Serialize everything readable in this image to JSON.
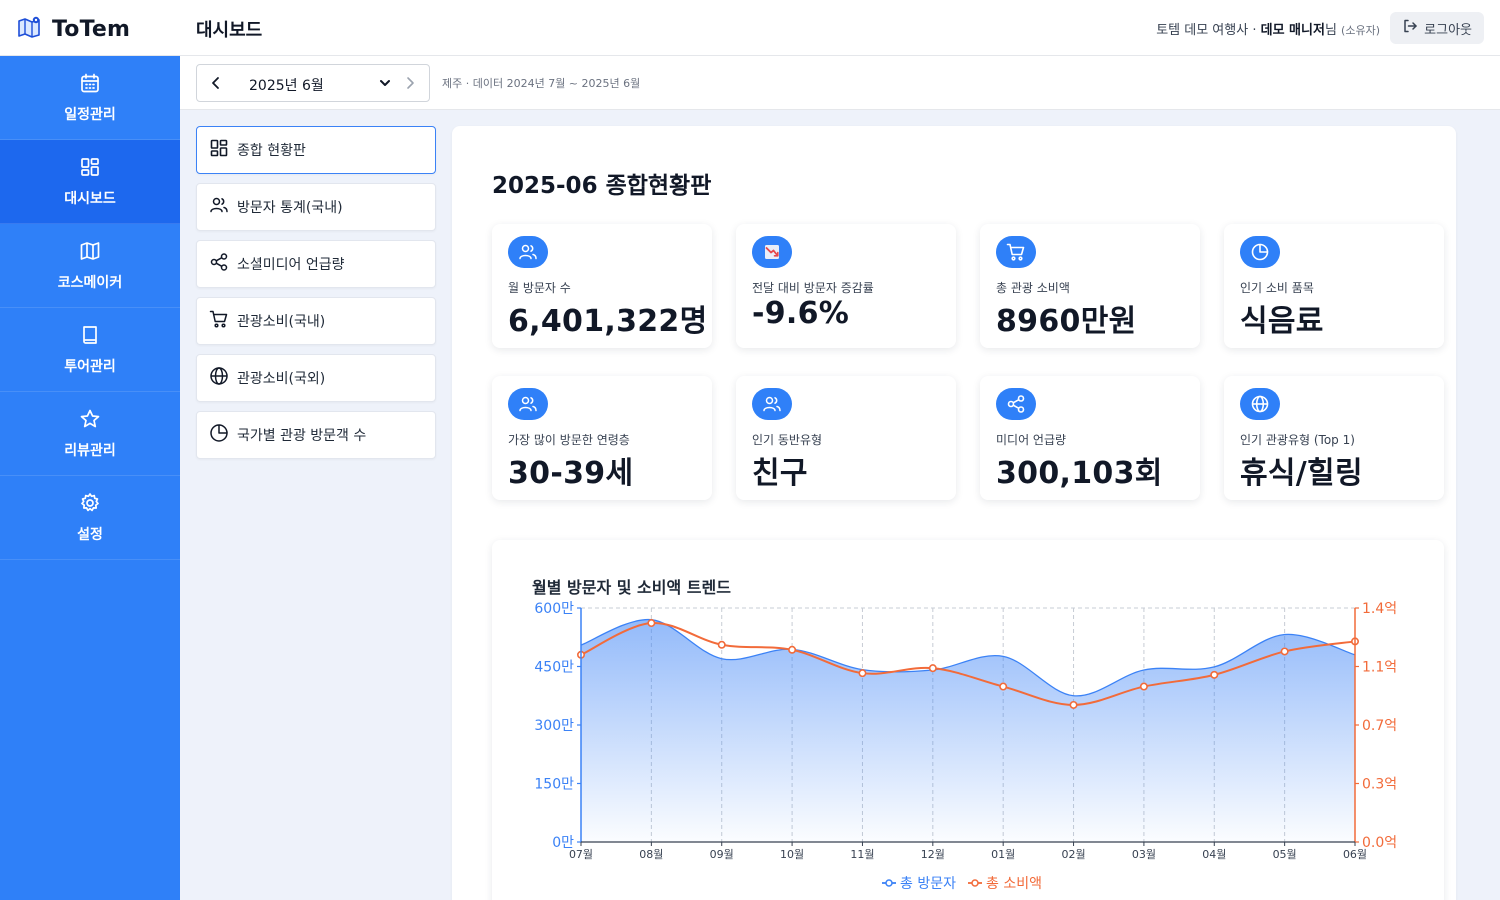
{
  "app": {
    "name": "ToTem"
  },
  "header": {
    "title": "대시보드",
    "company": "토템 데모 여행사",
    "separator": " · ",
    "user_name": "데모 매니저",
    "honorific": "님",
    "role": "(소유자)",
    "logout_label": "로그아웃"
  },
  "sidebar": {
    "items": [
      {
        "label": "일정관리",
        "icon": "calendar-icon",
        "active": false
      },
      {
        "label": "대시보드",
        "icon": "grid-icon",
        "active": true
      },
      {
        "label": "코스메이커",
        "icon": "map-icon",
        "active": false
      },
      {
        "label": "투어관리",
        "icon": "book-icon",
        "active": false
      },
      {
        "label": "리뷰관리",
        "icon": "star-icon",
        "active": false
      },
      {
        "label": "설정",
        "icon": "gear-icon",
        "active": false
      }
    ]
  },
  "subbar": {
    "selected_month": "2025년 6월",
    "data_range": "제주 · 데이터 2024년 7월 ~ 2025년 6월"
  },
  "submenu": {
    "items": [
      {
        "label": "종합 현황판",
        "icon": "dashboard-icon",
        "active": true
      },
      {
        "label": "방문자 통계(국내)",
        "icon": "users-icon",
        "active": false
      },
      {
        "label": "소셜미디어 언급량",
        "icon": "share-icon",
        "active": false
      },
      {
        "label": "관광소비(국내)",
        "icon": "cart-icon",
        "active": false
      },
      {
        "label": "관광소비(국외)",
        "icon": "globe-icon",
        "active": false
      },
      {
        "label": "국가별 관광 방문객 수",
        "icon": "pie-icon",
        "active": false
      }
    ]
  },
  "main": {
    "title": "2025-06 종합현황판",
    "kpis": [
      {
        "label": "월 방문자 수",
        "value": "6,401,322명",
        "icon": "users-icon"
      },
      {
        "label": "전달 대비 방문자 증감률",
        "value": "-9.6%",
        "icon": "trend-down-icon"
      },
      {
        "label": "총 관광 소비액",
        "value": "8960만원",
        "icon": "cart-icon"
      },
      {
        "label": "인기 소비 품목",
        "value": "식음료",
        "icon": "pie-icon"
      },
      {
        "label": "가장 많이 방문한 연령층",
        "value": "30-39세",
        "icon": "users-icon"
      },
      {
        "label": "인기 동반유형",
        "value": "친구",
        "icon": "users-icon"
      },
      {
        "label": "미디어 언급량",
        "value": "300,103회",
        "icon": "share-icon"
      },
      {
        "label": "인기 관광유형 (Top 1)",
        "value": "휴식/힐링",
        "icon": "globe-icon"
      }
    ]
  },
  "colors": {
    "primary": "#2f80f8",
    "sidebar_active": "#1d68ee",
    "visitors": "#3b82f6",
    "spending": "#f26b3a"
  },
  "chart_data": {
    "type": "line",
    "title": "월별 방문자 및 소비액 트렌드",
    "categories": [
      "07월",
      "08월",
      "09월",
      "10월",
      "11월",
      "12월",
      "01월",
      "02월",
      "03월",
      "04월",
      "05월",
      "06월"
    ],
    "series": [
      {
        "name": "총 방문자",
        "axis": "left",
        "style": "area",
        "color": "#3b82f6",
        "values": [
          5050000,
          5700000,
          4700000,
          4940000,
          4420000,
          4410000,
          4760000,
          3750000,
          4410000,
          4490000,
          5320000,
          4800000
        ]
      },
      {
        "name": "총 소비액",
        "axis": "right",
        "style": "line-markers",
        "color": "#f26b3a",
        "values": [
          112000000,
          131000000,
          118000000,
          115000000,
          101000000,
          104000000,
          93000000,
          82000000,
          93000000,
          100000000,
          114000000,
          120000000
        ]
      }
    ],
    "left_axis": {
      "ticks": [
        "0만",
        "150만",
        "300만",
        "450만",
        "600만"
      ],
      "range": [
        0,
        6000000
      ]
    },
    "right_axis": {
      "ticks": [
        "0.0억",
        "0.3억",
        "0.7억",
        "1.1억",
        "1.4억"
      ],
      "range": [
        0,
        140000000
      ]
    },
    "legend_position": "bottom",
    "grid": true
  }
}
